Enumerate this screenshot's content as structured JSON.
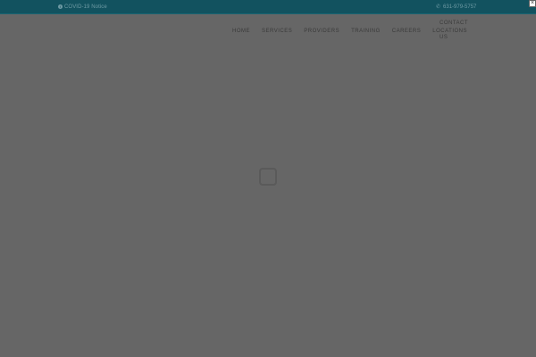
{
  "topbar": {
    "notice_text": "COVID-19 Notice",
    "notice_icon": "info-circle-icon",
    "phone_text": "631-979-5757",
    "phone_icon": "phone-icon",
    "background_color": "#12525f"
  },
  "nav": {
    "items": [
      {
        "label": "HOME"
      },
      {
        "label": "SERVICES"
      },
      {
        "label": "PROVIDERS"
      },
      {
        "label": "TRAINING"
      },
      {
        "label": "CAREERS"
      },
      {
        "label": "LOCATIONS"
      }
    ],
    "contact_line1": "CONTACT",
    "contact_line2": "US"
  },
  "overlay": {
    "close_symbol": "×",
    "color": "#666666"
  }
}
